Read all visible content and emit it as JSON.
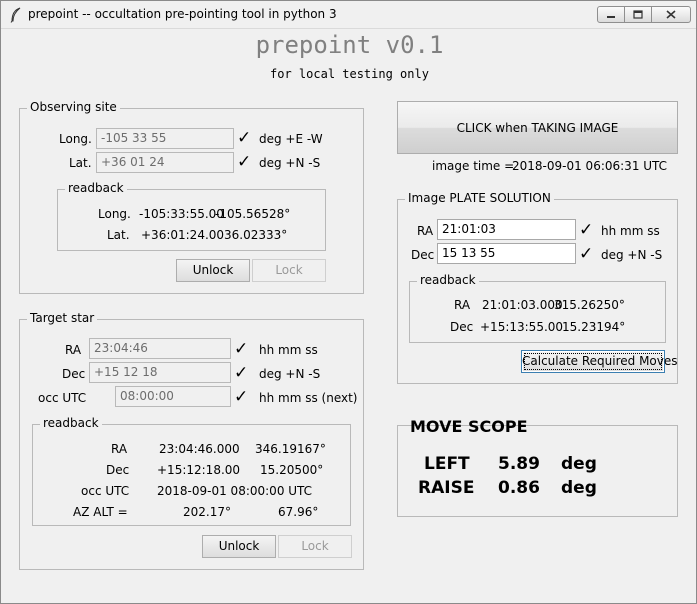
{
  "window": {
    "title": "prepoint  -- occultation pre-pointing tool in python 3"
  },
  "header": {
    "title": "prepoint v0.1",
    "subtitle": "for local testing only"
  },
  "observing_site": {
    "legend": "Observing site",
    "long_label": "Long.",
    "long_value": "-105 33 55",
    "long_units": "deg  +E  -W",
    "lat_label": "Lat.",
    "lat_value": "+36 01 24",
    "lat_units": "deg  +N  -S",
    "readback": {
      "legend": "readback",
      "long_label": "Long.",
      "long_sex": "-105:33:55.00",
      "long_deg": "-105.56528°",
      "lat_label": "Lat.",
      "lat_sex": "+36:01:24.00",
      "lat_deg": "36.02333°"
    },
    "unlock_label": "Unlock",
    "lock_label": "Lock"
  },
  "target_star": {
    "legend": "Target star",
    "ra_label": "RA",
    "ra_value": "23:04:46",
    "ra_units": "hh mm ss",
    "dec_label": "Dec",
    "dec_value": "+15 12 18",
    "dec_units": "deg  +N  -S",
    "occ_label": "occ UTC",
    "occ_value": "08:00:00",
    "occ_units": "hh mm ss (next)",
    "readback": {
      "legend": "readback",
      "ra_label": "RA",
      "ra_sex": "23:04:46.000",
      "ra_deg": "346.19167°",
      "dec_label": "Dec",
      "dec_sex": "+15:12:18.00",
      "dec_deg": "15.20500°",
      "occ_label": "occ UTC",
      "occ_value": "2018-09-01 08:00:00  UTC",
      "azalt_label": "AZ  ALT =",
      "az_value": "202.17°",
      "alt_value": "67.96°"
    },
    "unlock_label": "Unlock",
    "lock_label": "Lock"
  },
  "image": {
    "take_button_label": "CLICK when TAKING IMAGE",
    "time_label": "image time =",
    "time_value": "2018-09-01 06:06:31  UTC"
  },
  "plate_solution": {
    "legend": "Image PLATE SOLUTION",
    "ra_label": "RA",
    "ra_value": "21:01:03",
    "ra_units": "hh mm ss",
    "dec_label": "Dec",
    "dec_value": "15 13 55",
    "dec_units": "deg  +N  -S",
    "readback": {
      "legend": "readback",
      "ra_label": "RA",
      "ra_sex": "21:01:03.000",
      "ra_deg": "315.26250°",
      "dec_label": "Dec",
      "dec_sex": "+15:13:55.00",
      "dec_deg": "15.23194°"
    },
    "calc_button_label": "Calculate Required Moves"
  },
  "move_scope": {
    "title": "MOVE SCOPE",
    "left_label": "LEFT",
    "left_value": "5.89",
    "left_units": "deg",
    "raise_label": "RAISE",
    "raise_value": "0.86",
    "raise_units": "deg"
  },
  "icons": {
    "check": "✓",
    "feather": "feather-icon"
  }
}
